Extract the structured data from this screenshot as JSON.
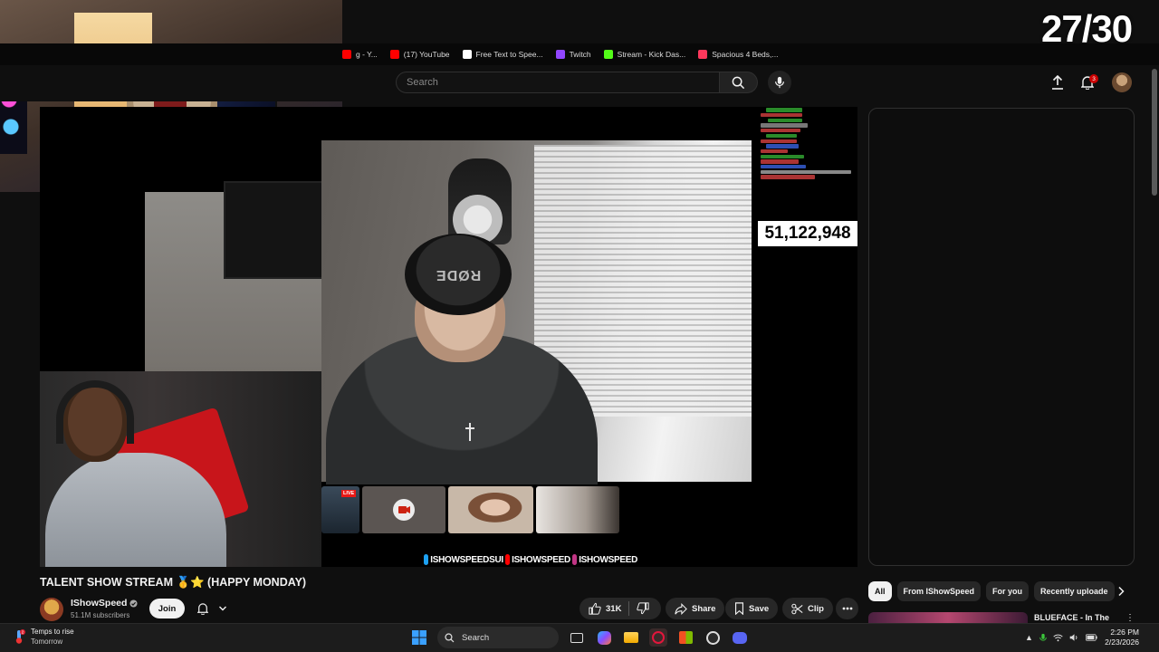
{
  "stream_counter": "27/30",
  "bookmarks": [
    {
      "label": "g - Y...",
      "icon": "youtube-icon",
      "color": "#ff0000"
    },
    {
      "label": "(17) YouTube",
      "icon": "youtube-icon",
      "color": "#ff0000"
    },
    {
      "label": "Free Text to Spee...",
      "icon": "tts-icon",
      "color": "#ffffff"
    },
    {
      "label": "Twitch",
      "icon": "twitch-icon",
      "color": "#9146ff"
    },
    {
      "label": "Stream - Kick Das...",
      "icon": "kick-icon",
      "color": "#53fc18"
    },
    {
      "label": "Spacious 4 Beds,...",
      "icon": "airbnb-icon",
      "color": "#ff385c"
    }
  ],
  "header": {
    "search_placeholder": "Search",
    "notification_count": "3"
  },
  "player": {
    "view_count_overlay": "51,122,948",
    "rode_text": "RØDE",
    "live_tag": "LIVE",
    "socials": [
      {
        "icon": "twitter-icon",
        "color": "#1da1f2",
        "handle": "ISHOWSPEEDSUI"
      },
      {
        "icon": "youtube-icon",
        "color": "#ff0000",
        "handle": "ISHOWSPEED"
      },
      {
        "icon": "instagram-icon",
        "color": "#c13584",
        "handle": "ISHOWSPEED"
      }
    ]
  },
  "video": {
    "title": "TALENT SHOW STREAM 🥇⭐ (HAPPY MONDAY)",
    "channel_name": "IShowSpeed",
    "subscribers": "51.1M subscribers",
    "join_label": "Join",
    "likes": "31K",
    "share_label": "Share",
    "save_label": "Save",
    "clip_label": "Clip"
  },
  "sidebar": {
    "chips": [
      {
        "label": "All",
        "active": true
      },
      {
        "label": "From IShowSpeed",
        "active": false
      },
      {
        "label": "For you",
        "active": false
      },
      {
        "label": "Recently uploade",
        "active": false
      }
    ],
    "next_video_title": "BLUEFACE - In The"
  },
  "taskbar": {
    "weather_title": "Temps to rise",
    "weather_sub": "Tomorrow",
    "weather_badge": "2",
    "search_label": "Search",
    "time": "2:26 PM",
    "date": "2/23/2026"
  },
  "colors": {
    "accent": "#cc0000",
    "background": "#0f0f0f",
    "chip": "#272727"
  }
}
